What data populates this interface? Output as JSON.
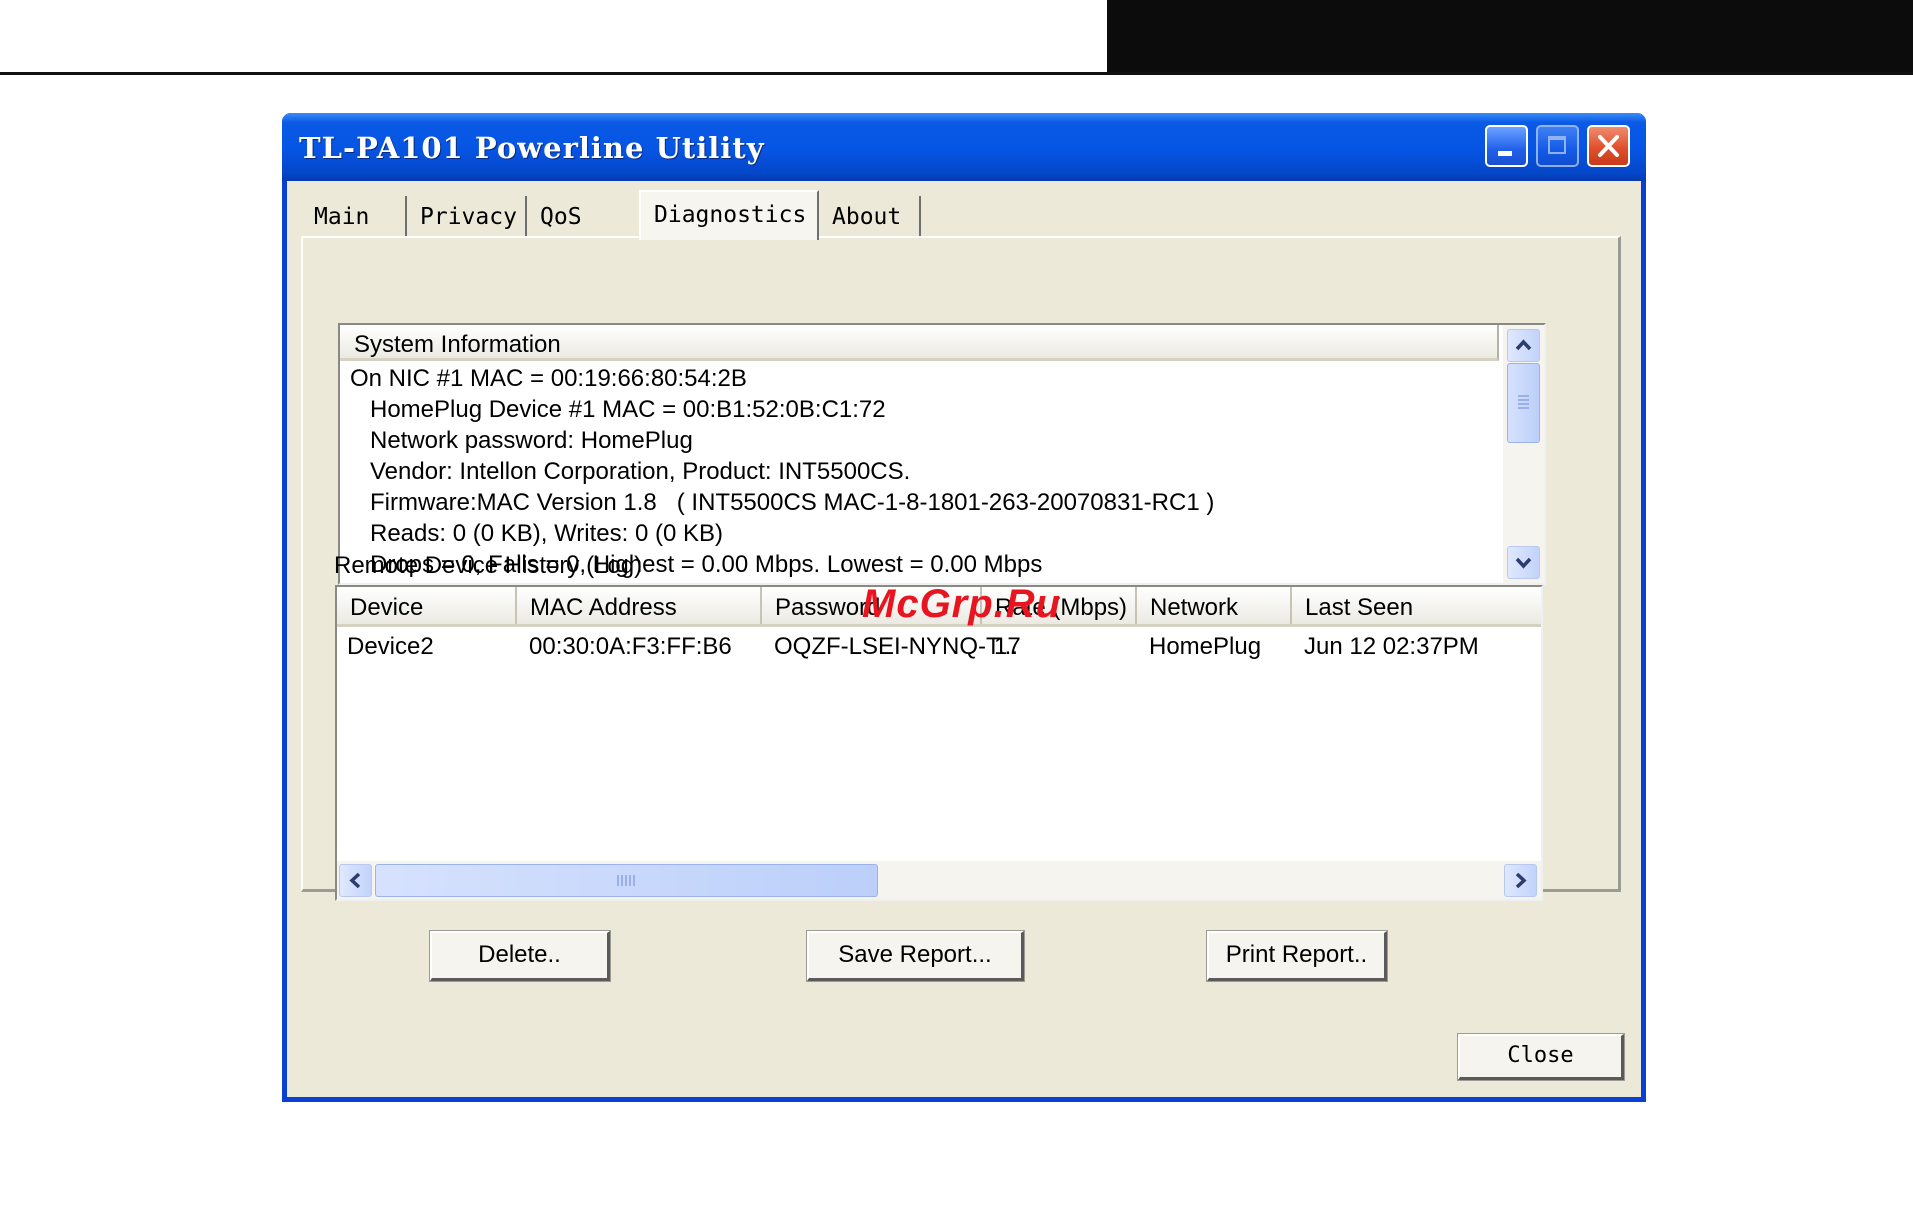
{
  "window": {
    "title": "TL-PA101 Powerline Utility",
    "minimize_icon": "minimize-icon",
    "maximize_icon": "maximize-icon",
    "close_icon": "close-icon"
  },
  "tabs": [
    {
      "label": "Main"
    },
    {
      "label": "Privacy"
    },
    {
      "label": "QoS"
    },
    {
      "label": "Diagnostics",
      "active": true
    },
    {
      "label": "About"
    }
  ],
  "system_information": {
    "header": "System Information",
    "lines": [
      "On NIC #1 MAC = 00:19:66:80:54:2B",
      "HomePlug Device #1 MAC = 00:B1:52:0B:C1:72",
      "Network password: HomePlug",
      "Vendor: Intellon Corporation, Product: INT5500CS.",
      "Firmware:MAC Version 1.8   ( INT5500CS MAC-1-8-1801-263-20070831-RC1 )",
      "Reads: 0 (0 KB), Writes: 0 (0 KB)",
      "Drops = 0, Fails = 0, Highest = 0.00 Mbps. Lowest = 0.00 Mbps"
    ]
  },
  "remote_history": {
    "label": "Remote Device History (Log)",
    "columns": [
      "Device",
      "MAC Address",
      "Password",
      "Rate (Mbps)",
      "Network",
      "Last Seen"
    ],
    "rows": [
      [
        "Device2",
        "00:30:0A:F3:FF:B6",
        "OQZF-LSEI-NYNQ-T...",
        "17",
        "HomePlug",
        "Jun 12 02:37PM"
      ]
    ]
  },
  "buttons": {
    "delete": "Delete..",
    "save_report": "Save Report...",
    "print_report": "Print Report..",
    "close": "Close"
  },
  "watermark": "McGrp.Ru",
  "colors": {
    "titlebar": "#0654e3",
    "client_bg": "#ece9d8",
    "close_button": "#e0502c",
    "watermark": "#e8141f"
  }
}
